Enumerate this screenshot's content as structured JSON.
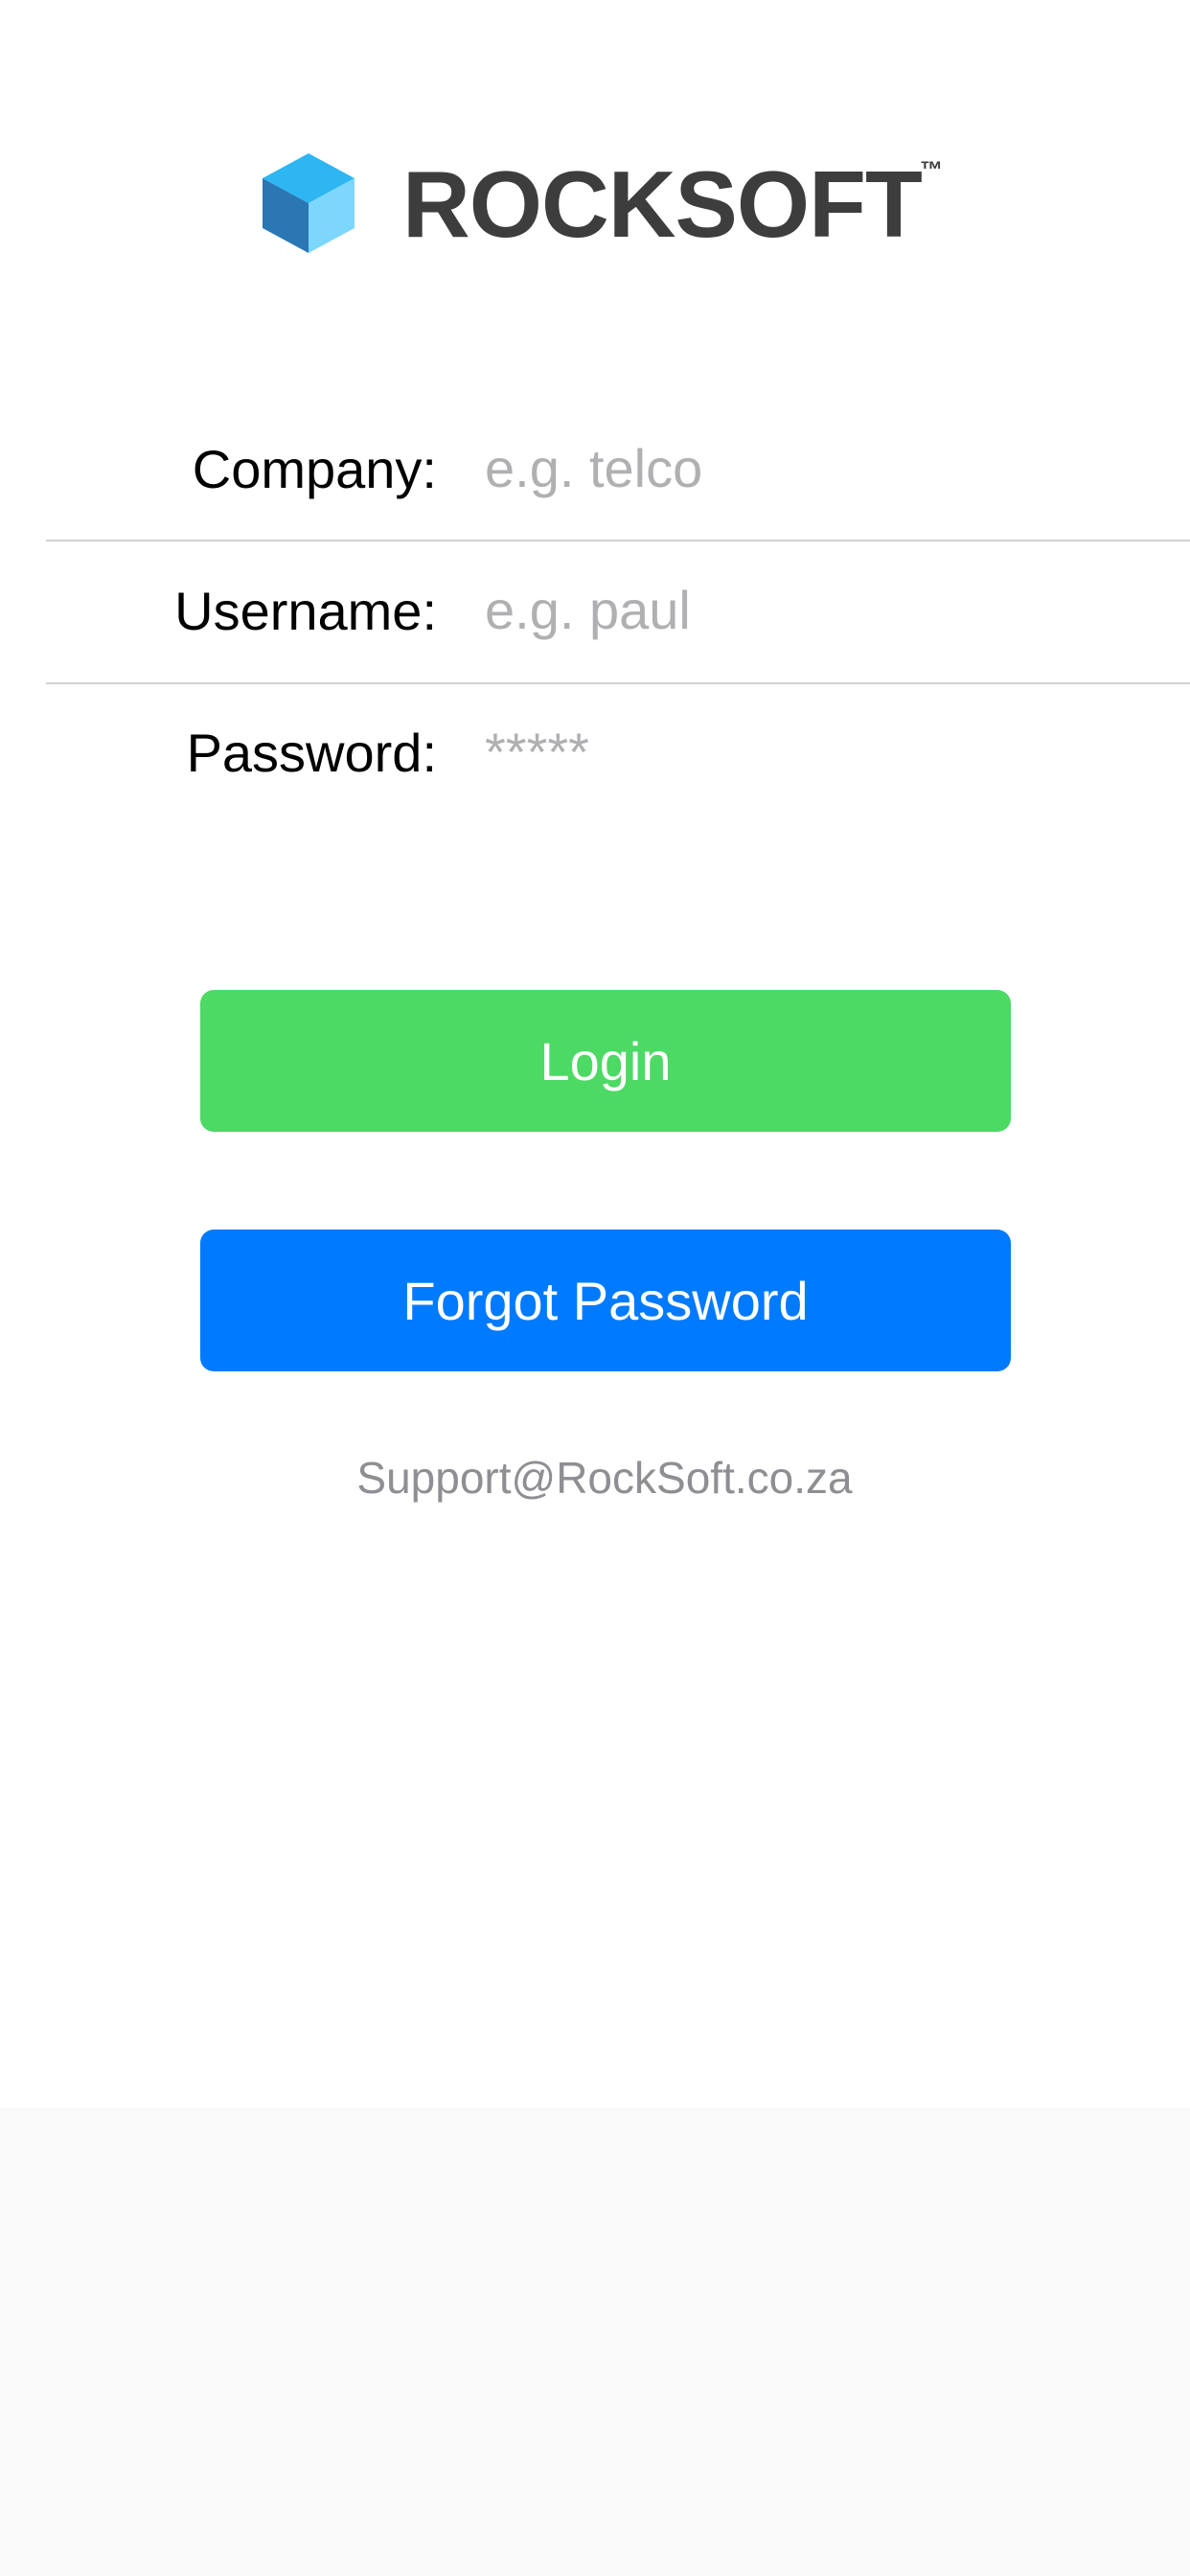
{
  "brand": {
    "logo_icon": "cube-icon",
    "name": "ROCKSOFT",
    "trademark": "™",
    "cube_colors": {
      "top": "#2eb6f2",
      "left": "#2a77b4",
      "right": "#7dd6fc"
    }
  },
  "form": {
    "company": {
      "label": "Company:",
      "placeholder": "e.g. telco",
      "value": ""
    },
    "username": {
      "label": "Username:",
      "placeholder": "e.g. paul",
      "value": ""
    },
    "password": {
      "label": "Password:",
      "placeholder": "*****",
      "value": ""
    }
  },
  "buttons": {
    "login_label": "Login",
    "login_color": "#4cd964",
    "forgot_label": "Forgot Password",
    "forgot_color": "#007aff"
  },
  "support": {
    "email": "Support@RockSoft.co.za"
  }
}
